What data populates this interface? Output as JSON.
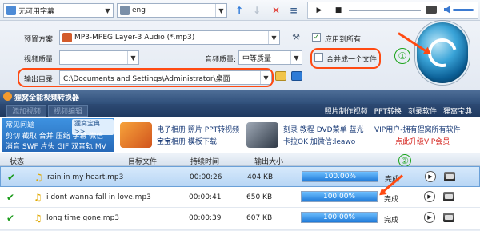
{
  "toolbar": {
    "subtitle_select": "无可用字幕",
    "audio_select": "eng",
    "up_arrow": "↑",
    "down_arrow": "↓",
    "delete": "✕",
    "list": "≡",
    "play": "▶",
    "stop": "■"
  },
  "settings": {
    "preset_label": "预置方案:",
    "preset_value": "MP3-MPEG Layer-3 Audio (*.mp3)",
    "video_quality_label": "视频质量:",
    "video_quality_value": "",
    "audio_quality_label": "音频质量:",
    "audio_quality_value": "中等质量",
    "apply_all_label": "应用到所有",
    "apply_all_checked": "✓",
    "merge_label": "合并成一个文件",
    "output_label": "输出目录:",
    "output_path": "C:\\Documents and Settings\\Administrator\\桌面",
    "marker_1": "①",
    "marker_2": "②"
  },
  "window": {
    "title": "狸窝全能视频转换器",
    "menu_dim_1": "添加视频",
    "menu_dim_2": "视频编辑",
    "menu_items": [
      "照片制作视频",
      "PPT转换",
      "刻录软件",
      "狸窝宝典"
    ]
  },
  "banner": {
    "faq_title": "常见问题",
    "faq_tag": "狸窝宝典 >>",
    "faq_line1": "剪切 截取 合并 压缩 字幕 微信",
    "faq_line2": "消音 SWF 片头 GIF 双音轨 MV",
    "promo1_line1": "电子相册 照片 PPT转视频",
    "promo1_line2": "宝宝相册 模板下载",
    "promo2_line1": "刻录 教程 DVD菜单 蓝光",
    "promo2_line2": "卡拉OK 加微信:leawo",
    "promo3_line1": "VIP用户-拥有狸窝所有软件",
    "promo3_line2": "点此升级VIP会员"
  },
  "table": {
    "headers": [
      "状态",
      "目标文件",
      "持续时间",
      "输出大小"
    ],
    "rows": [
      {
        "file": "rain in my heart.mp3",
        "duration": "00:00:26",
        "size": "404 KB",
        "progress": "100.00%",
        "progress_value": 1.0,
        "status": "完成"
      },
      {
        "file": "i dont wanna fall in love.mp3",
        "duration": "00:00:41",
        "size": "650 KB",
        "progress": "100.00%",
        "progress_value": 1.0,
        "status": "完成"
      },
      {
        "file": "long time gone.mp3",
        "duration": "00:00:39",
        "size": "607 KB",
        "progress": "100.00%",
        "progress_value": 1.0,
        "status": "完成"
      }
    ]
  },
  "colors": {
    "accent_red": "#ff4a12",
    "marker_green": "#19a319",
    "progress_blue": "#1f7ad8"
  }
}
